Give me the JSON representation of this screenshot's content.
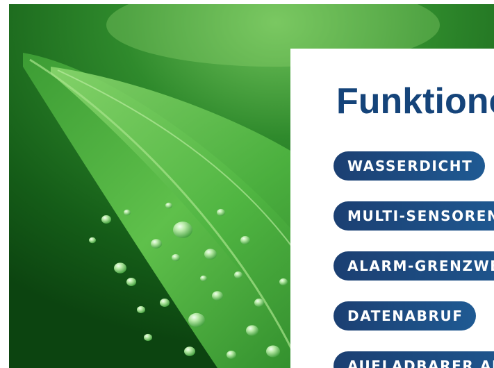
{
  "panel": {
    "title": "Funktionen",
    "features": [
      {
        "label": "WASSERDICHT"
      },
      {
        "label": "MULTI-SENSOREN"
      },
      {
        "label": "ALARM-GRENZWERTE"
      },
      {
        "label": "DATENABRUF"
      },
      {
        "label": "AUFLADBARER AKKU"
      }
    ]
  },
  "colors": {
    "title": "#15447a",
    "pill_start": "#1b3f72",
    "pill_end": "#1f5a93",
    "leaf_green": "#3fae3f"
  }
}
